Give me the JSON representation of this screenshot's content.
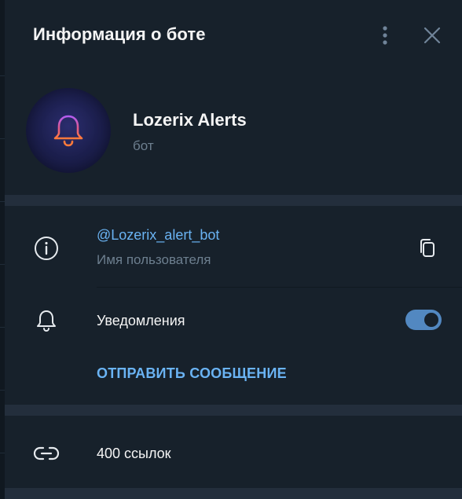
{
  "header": {
    "title": "Информация о боте",
    "menu_icon": "more-vertical-icon",
    "close_icon": "close-icon"
  },
  "profile": {
    "name": "Lozerix Alerts",
    "subtitle": "бот",
    "avatar_icon": "bell-icon"
  },
  "info": {
    "username": "@Lozerix_alert_bot",
    "username_label": "Имя пользователя",
    "info_icon": "info-icon",
    "copy_icon": "copy-icon"
  },
  "notifications": {
    "label": "Уведомления",
    "icon": "bell-outline-icon",
    "enabled": true
  },
  "actions": {
    "send_message": "ОТПРАВИТЬ СООБЩЕНИЕ"
  },
  "links": {
    "label": "400 ссылок",
    "icon": "link-icon"
  },
  "colors": {
    "panel_bg": "#17212b",
    "divider": "#232e3c",
    "accent": "#6ab3f3",
    "toggle": "#5288c1",
    "muted_text": "#6d7f8f",
    "text": "#f5f5f5"
  }
}
